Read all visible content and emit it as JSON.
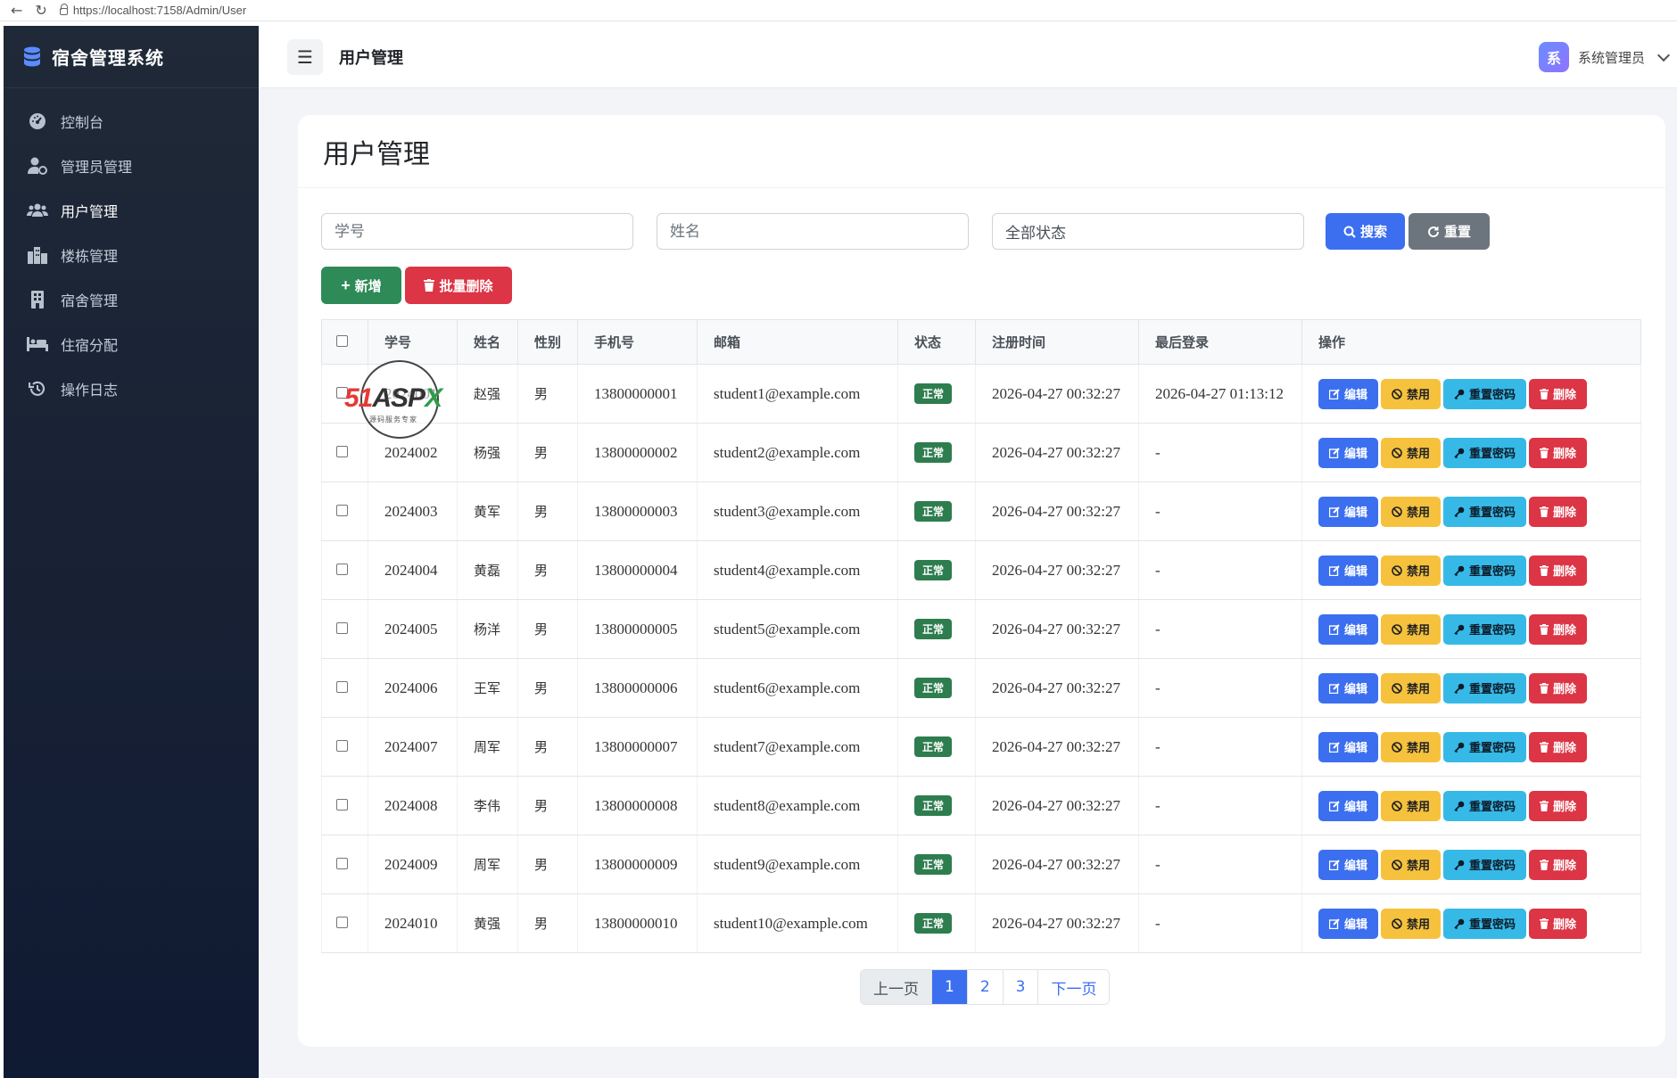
{
  "browser": {
    "url": "https://localhost:7158/Admin/User"
  },
  "sidebar": {
    "brand": "宿舍管理系统",
    "items": [
      {
        "label": "控制台",
        "icon": "dashboard-icon"
      },
      {
        "label": "管理员管理",
        "icon": "user-cog-icon"
      },
      {
        "label": "用户管理",
        "icon": "users-icon"
      },
      {
        "label": "楼栋管理",
        "icon": "city-icon"
      },
      {
        "label": "宿舍管理",
        "icon": "building-icon"
      },
      {
        "label": "住宿分配",
        "icon": "bed-icon"
      },
      {
        "label": "操作日志",
        "icon": "history-icon"
      }
    ]
  },
  "topbar": {
    "title": "用户管理",
    "avatar_char": "系",
    "username": "系统管理员"
  },
  "page": {
    "title": "用户管理"
  },
  "filters": {
    "student_id_placeholder": "学号",
    "name_placeholder": "姓名",
    "status_value": "全部状态",
    "search_label": "搜索",
    "reset_label": "重置"
  },
  "toolbar": {
    "add_label": "新增",
    "batch_delete_label": "批量删除"
  },
  "table": {
    "headers": [
      "学号",
      "姓名",
      "性别",
      "手机号",
      "邮箱",
      "状态",
      "注册时间",
      "最后登录",
      "操作"
    ],
    "rows": [
      {
        "id": "2024001",
        "name": "赵强",
        "gender": "男",
        "phone": "13800000001",
        "email": "student1@example.com",
        "status": "正常",
        "registered": "2026-04-27 00:32:27",
        "last_login": "2026-04-27 01:13:12"
      },
      {
        "id": "2024002",
        "name": "杨强",
        "gender": "男",
        "phone": "13800000002",
        "email": "student2@example.com",
        "status": "正常",
        "registered": "2026-04-27 00:32:27",
        "last_login": "-"
      },
      {
        "id": "2024003",
        "name": "黄军",
        "gender": "男",
        "phone": "13800000003",
        "email": "student3@example.com",
        "status": "正常",
        "registered": "2026-04-27 00:32:27",
        "last_login": "-"
      },
      {
        "id": "2024004",
        "name": "黄磊",
        "gender": "男",
        "phone": "13800000004",
        "email": "student4@example.com",
        "status": "正常",
        "registered": "2026-04-27 00:32:27",
        "last_login": "-"
      },
      {
        "id": "2024005",
        "name": "杨洋",
        "gender": "男",
        "phone": "13800000005",
        "email": "student5@example.com",
        "status": "正常",
        "registered": "2026-04-27 00:32:27",
        "last_login": "-"
      },
      {
        "id": "2024006",
        "name": "王军",
        "gender": "男",
        "phone": "13800000006",
        "email": "student6@example.com",
        "status": "正常",
        "registered": "2026-04-27 00:32:27",
        "last_login": "-"
      },
      {
        "id": "2024007",
        "name": "周军",
        "gender": "男",
        "phone": "13800000007",
        "email": "student7@example.com",
        "status": "正常",
        "registered": "2026-04-27 00:32:27",
        "last_login": "-"
      },
      {
        "id": "2024008",
        "name": "李伟",
        "gender": "男",
        "phone": "13800000008",
        "email": "student8@example.com",
        "status": "正常",
        "registered": "2026-04-27 00:32:27",
        "last_login": "-"
      },
      {
        "id": "2024009",
        "name": "周军",
        "gender": "男",
        "phone": "13800000009",
        "email": "student9@example.com",
        "status": "正常",
        "registered": "2026-04-27 00:32:27",
        "last_login": "-"
      },
      {
        "id": "2024010",
        "name": "黄强",
        "gender": "男",
        "phone": "13800000010",
        "email": "student10@example.com",
        "status": "正常",
        "registered": "2026-04-27 00:32:27",
        "last_login": "-"
      }
    ],
    "row_actions": {
      "edit": "编辑",
      "disable": "禁用",
      "reset_password": "重置密码",
      "delete": "删除"
    }
  },
  "pagination": {
    "prev": "上一页",
    "pages": [
      "1",
      "2",
      "3"
    ],
    "next": "下一页",
    "current": "1"
  },
  "watermark": {
    "text": "51ASPX",
    "subtitle": "源码服务专家"
  },
  "colors": {
    "primary": "#3b6ff0",
    "success": "#2e8b57",
    "danger": "#dc3545",
    "warning": "#f6c23e",
    "info": "#36b9e6",
    "secondary": "#6c757d",
    "sidebar": "#1f2937"
  }
}
